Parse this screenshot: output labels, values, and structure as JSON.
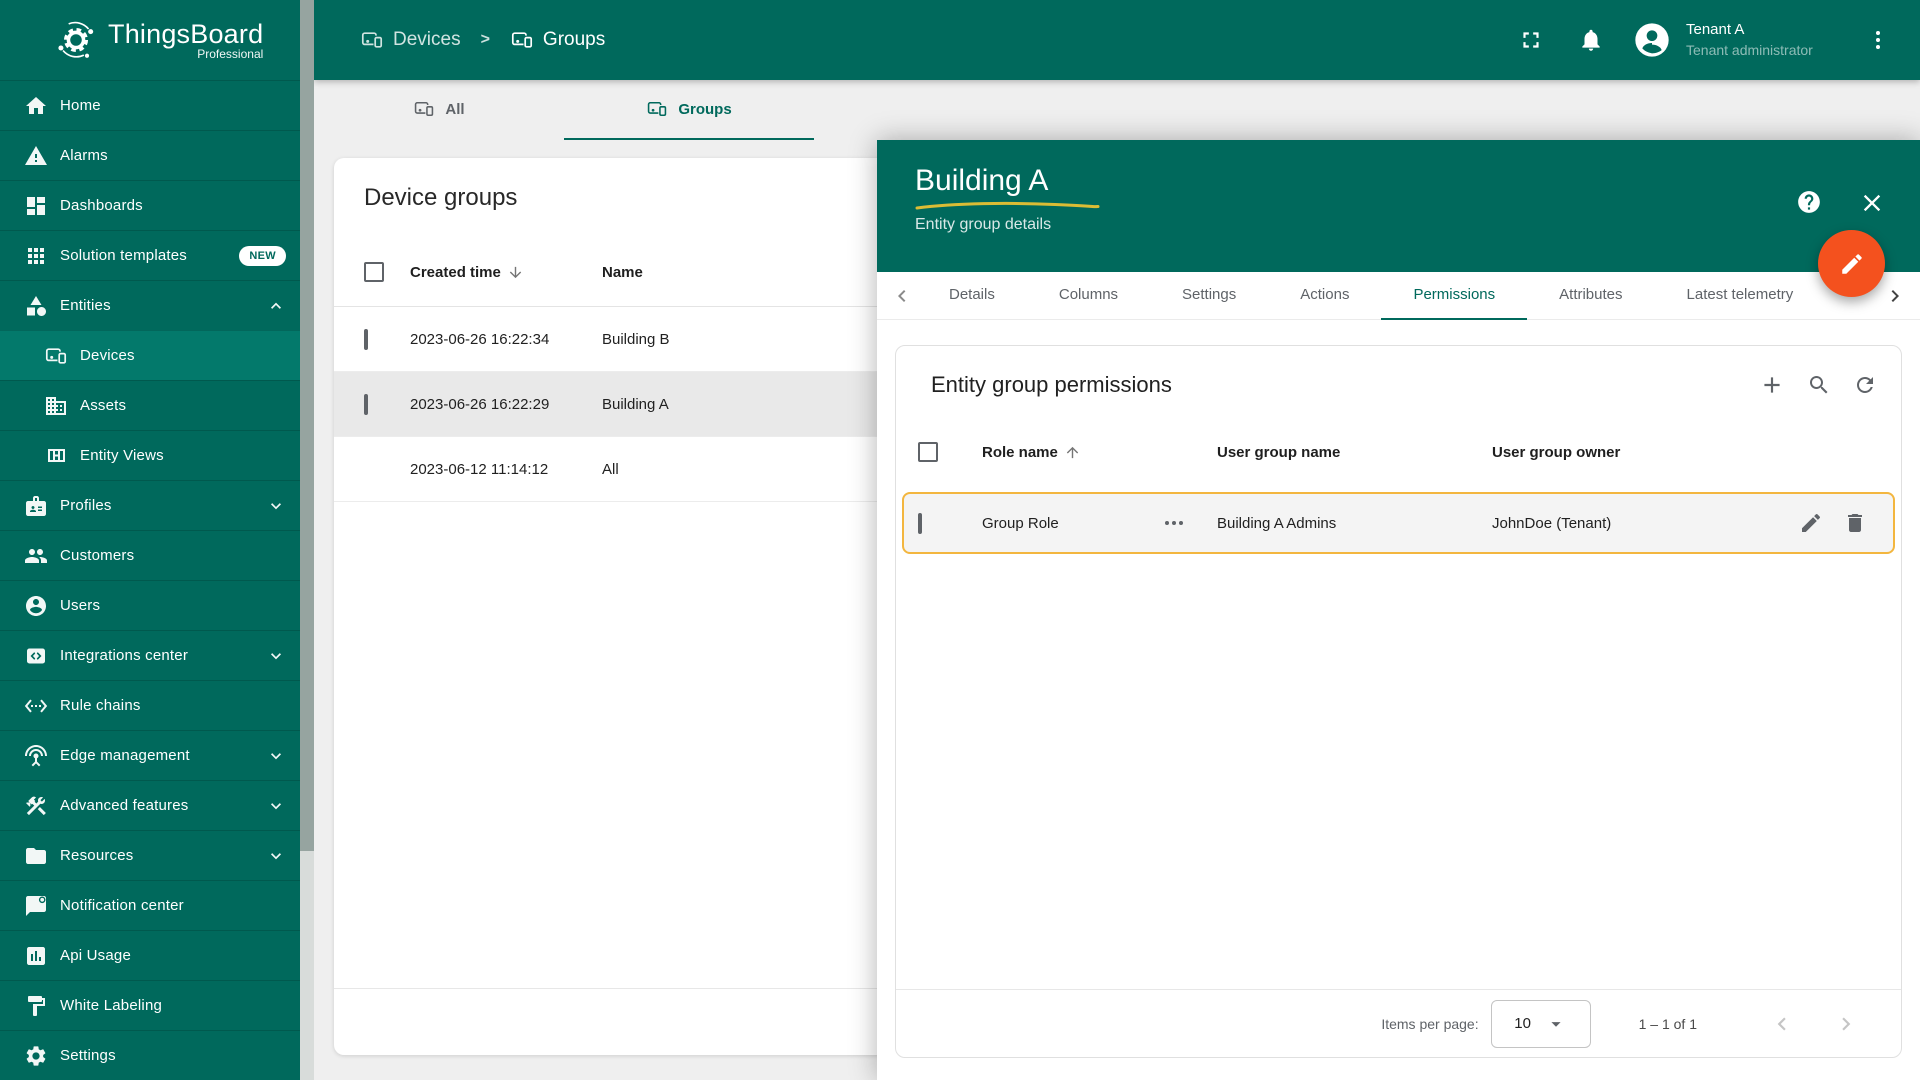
{
  "brand": {
    "name": "ThingsBoard",
    "edition": "Professional"
  },
  "colors": {
    "primary_teal": "#00695C",
    "accent_orange": "#F4511E",
    "highlight_amber": "#F3B63F",
    "new_badge_bg": "#FFFFFF"
  },
  "sidebar": {
    "items": [
      {
        "label": "Home",
        "icon": "home"
      },
      {
        "label": "Alarms",
        "icon": "warning"
      },
      {
        "label": "Dashboards",
        "icon": "dashboard"
      },
      {
        "label": "Solution templates",
        "icon": "apps",
        "badge": "NEW"
      },
      {
        "label": "Entities",
        "icon": "category",
        "chevron": "up"
      },
      {
        "label": "Devices",
        "icon": "devices",
        "sub": true,
        "active": true
      },
      {
        "label": "Assets",
        "icon": "domain",
        "sub": true
      },
      {
        "label": "Entity Views",
        "icon": "view-quilt",
        "sub": true
      },
      {
        "label": "Profiles",
        "icon": "badge",
        "chevron": "down"
      },
      {
        "label": "Customers",
        "icon": "people"
      },
      {
        "label": "Users",
        "icon": "account"
      },
      {
        "label": "Integrations center",
        "icon": "integration",
        "chevron": "down"
      },
      {
        "label": "Rule chains",
        "icon": "ethernet"
      },
      {
        "label": "Edge management",
        "icon": "antenna",
        "chevron": "down"
      },
      {
        "label": "Advanced features",
        "icon": "construction",
        "chevron": "down"
      },
      {
        "label": "Resources",
        "icon": "folder",
        "chevron": "down"
      },
      {
        "label": "Notification center",
        "icon": "message"
      },
      {
        "label": "Api Usage",
        "icon": "chart"
      },
      {
        "label": "White Labeling",
        "icon": "paint"
      },
      {
        "label": "Settings",
        "icon": "gear"
      }
    ]
  },
  "header": {
    "breadcrumbs": [
      {
        "label": "Devices",
        "icon": "devices"
      },
      {
        "label": "Groups",
        "icon": "devices"
      }
    ],
    "separator": ">",
    "user": {
      "name": "Tenant A",
      "role": "Tenant administrator"
    }
  },
  "tabs": [
    {
      "label": "All",
      "icon": "devices"
    },
    {
      "label": "Groups",
      "icon": "devices",
      "active": true
    }
  ],
  "device_groups": {
    "title": "Device groups",
    "columns": [
      "Created time",
      "Name"
    ],
    "sort_column": "Created time",
    "sort_direction": "desc",
    "rows": [
      {
        "created_time": "2023-06-26 16:22:34",
        "name": "Building B",
        "checkbox": true
      },
      {
        "created_time": "2023-06-26 16:22:29",
        "name": "Building A",
        "checkbox": true,
        "selected": true
      },
      {
        "created_time": "2023-06-12 11:14:12",
        "name": "All",
        "checkbox": false
      }
    ]
  },
  "panel": {
    "title": "Building A",
    "subtitle": "Entity group details",
    "tabs": [
      {
        "label": "Details"
      },
      {
        "label": "Columns"
      },
      {
        "label": "Settings"
      },
      {
        "label": "Actions"
      },
      {
        "label": "Permissions",
        "active": true
      },
      {
        "label": "Attributes"
      },
      {
        "label": "Latest telemetry"
      }
    ],
    "permissions": {
      "title": "Entity group permissions",
      "columns": [
        "Role name",
        "User group name",
        "User group owner"
      ],
      "sort_column": "Role name",
      "sort_direction": "asc",
      "rows": [
        {
          "role_name": "Group Role",
          "user_group_name": "Building A Admins",
          "user_group_owner": "JohnDoe (Tenant)",
          "highlighted": true
        }
      ]
    },
    "pagination": {
      "items_per_page_label": "Items per page:",
      "items_per_page": "10",
      "range": "1 – 1 of 1"
    }
  }
}
